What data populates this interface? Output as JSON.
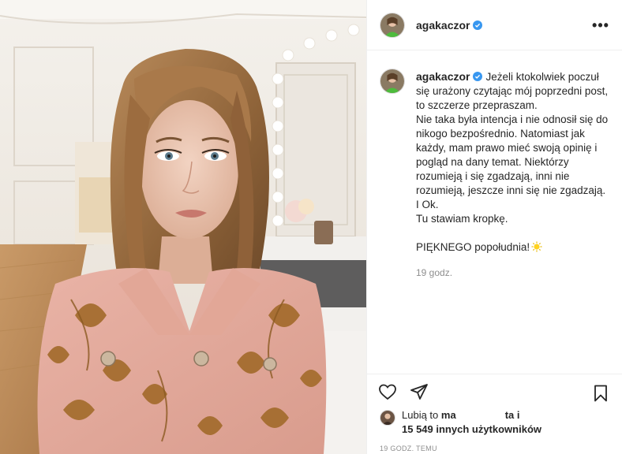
{
  "post": {
    "author": {
      "username": "agakaczor",
      "verified": true,
      "avatar_icon": "profile-avatar"
    },
    "more_icon": "more-options-icon",
    "more_label": "•••",
    "caption": {
      "username": "agakaczor",
      "text": "Jeżeli ktokolwiek poczuł się urażony czytając mój poprzedni post, to szczerze przepraszam.\nNie taka była intencja i nie odnosił się do nikogo bezpośrednio. Natomiast jak każdy, mam prawo mieć swoją opinię i pogląd na dany temat. Niektórzy rozumieją i się zgadzają, inni nie rozumieją, jeszcze inni się nie zgadzają. I Ok.\nTu stawiam kropkę.\n\nPIĘKNEGO popołudnia!",
      "emoji_icon": "sun-emoji-icon",
      "time": "19 godz."
    },
    "actions": {
      "like_icon": "heart-icon",
      "share_icon": "send-icon",
      "save_icon": "bookmark-icon"
    },
    "likes": {
      "prefix": "Lubią to",
      "liker_visible": "ma",
      "suffix": "ta i",
      "count_text": "15 549 innych użytkowników"
    },
    "timestamp": "19 godz. temu"
  },
  "colors": {
    "text": "#262626",
    "secondary_text": "#8e8e8e",
    "verified_blue": "#3897f0",
    "border": "#efefef"
  }
}
